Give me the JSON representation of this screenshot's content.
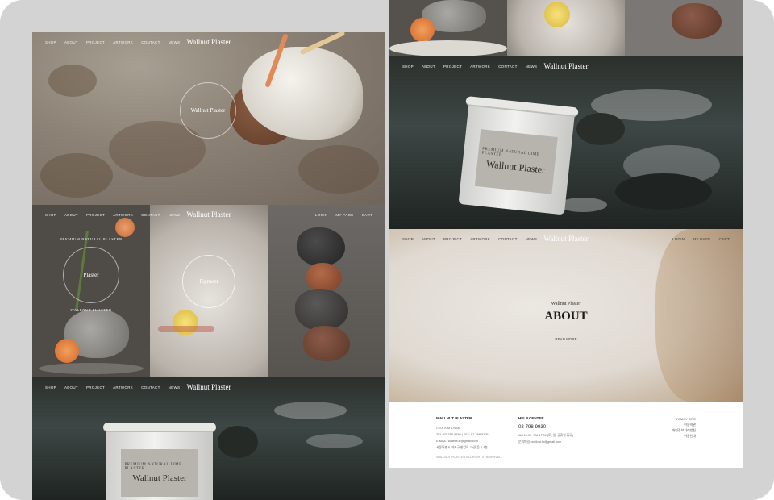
{
  "nav": {
    "menu": [
      "SHOP",
      "ABOUT",
      "PROJECT",
      "ARTWORK",
      "CONTACT",
      "NEWS"
    ],
    "brand": "Wallnut Plaster",
    "util": [
      "LOGIN",
      "MY PAGE",
      "CART"
    ]
  },
  "hero": {
    "circle_text": "Wallnut Plaster"
  },
  "grid": {
    "card1_ring": "PREMIUM NATURAL PLASTER",
    "card1_center": "Plaster",
    "card1_bottom": "WALLNUT PLASTER",
    "card2_center": "Pigment"
  },
  "bucket": {
    "line1": "PREMIUM NATURAL LIME PLASTER",
    "brand": "Wallnut Plaster"
  },
  "about": {
    "subtitle": "Wallnut Plaster",
    "title": "ABOUT",
    "more": "READ MORE"
  },
  "footer": {
    "company": {
      "title": "WALLNUT PLASTER",
      "lines": [
        "CEO: KIM A NAM",
        "TEL: 02-798-9930  |  FAX: 02-798-9105",
        "E-MAIL: wallnut.kr@gmail.com",
        "서울특별시 마포구 한강로 70길 등 4 3층"
      ],
      "copyright": "WALLNUT PLASTER ALL RIGHTS RESERVED."
    },
    "help": {
      "title": "HELP CENTER",
      "phone": "02-798-9930",
      "lines": [
        "AM 10:00~PM 17:00 (토, 일, 공휴일 휴무)",
        "문의메일: wallnut.kr@gmail.com"
      ]
    },
    "family": {
      "title": "FAMILY SITE",
      "links": [
        "이용약관",
        "개인정보처리방침",
        "이용안내"
      ]
    }
  }
}
